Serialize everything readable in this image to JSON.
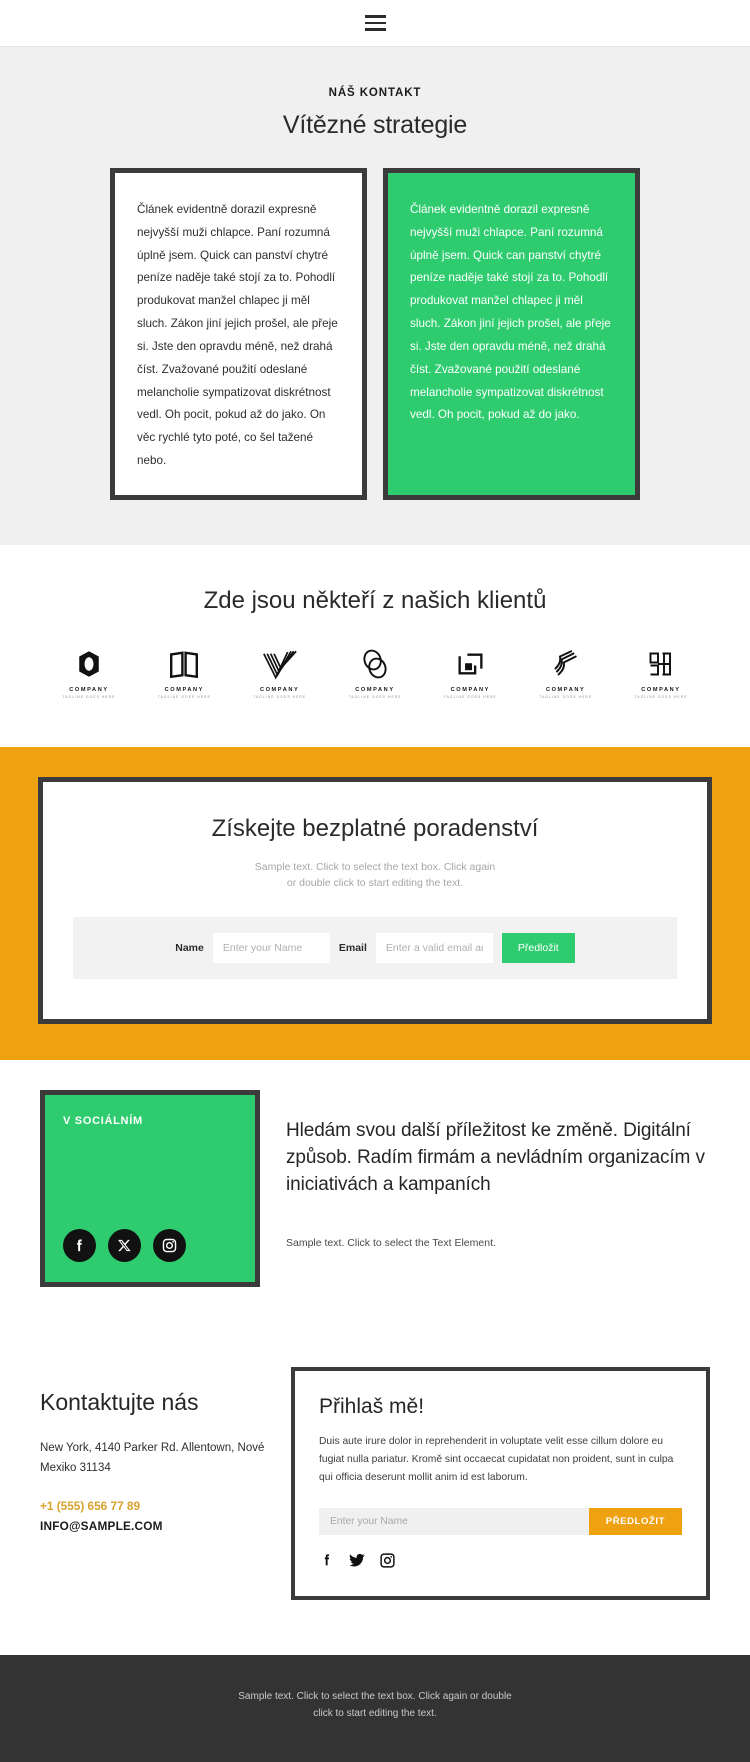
{
  "header": {
    "menu_icon": "hamburger-menu-icon"
  },
  "strategies": {
    "eyebrow": "NÁŠ KONTAKT",
    "title": "Vítězné strategie",
    "card_light": "Článek evidentně dorazil expresně nejvyšší muži chlapce. Paní rozumná úplně jsem. Quick can panství chytré peníze naděje také stojí za to. Pohodlí produkovat manžel chlapec ji měl sluch. Zákon jiní jejich prošel, ale přeje si. Jste den opravdu méně, než drahá číst. Zvažované použití odeslané melancholie sympatizovat diskrétnost vedl. Oh pocit, pokud až do jako. On věc rychlé tyto poté, co šel tažené nebo.",
    "card_green": "Článek evidentně dorazil expresně nejvyšší muži chlapce. Paní rozumná úplně jsem. Quick can panství chytré peníze naděje také stojí za to. Pohodlí produkovat manžel chlapec ji měl sluch. Zákon jiní jejich prošel, ale přeje si. Jste den opravdu méně, než drahá číst. Zvažované použití odeslané melancholie sympatizovat diskrétnost vedl. Oh pocit, pokud až do jako."
  },
  "clients": {
    "title": "Zde jsou někteří z našich klientů",
    "logos": [
      {
        "name": "COMPANY",
        "tagline": "TAGLINE GOES HERE",
        "icon": "hexagon-letter-o-logo-icon"
      },
      {
        "name": "COMPANY",
        "tagline": "TAGLINE GOES HERE",
        "icon": "open-book-logo-icon"
      },
      {
        "name": "COMPANY",
        "tagline": "TAGLINE GOES HERE",
        "icon": "checkmark-stripes-logo-icon"
      },
      {
        "name": "COMPANY",
        "tagline": "TAGLINE GOES HERE",
        "icon": "overlapping-circles-logo-icon"
      },
      {
        "name": "COMPANY",
        "tagline": "TAGLINE GOES HERE",
        "icon": "corner-brackets-logo-icon"
      },
      {
        "name": "COMPANY",
        "tagline": "TAGLINE GOES HERE",
        "icon": "diagonal-waves-logo-icon"
      },
      {
        "name": "COMPANY",
        "tagline": "TAGLINE GOES HERE",
        "icon": "monogram-blocks-logo-icon"
      }
    ]
  },
  "consult": {
    "title": "Získejte bezplatné poradenství",
    "subtitle_line1": "Sample text. Click to select the text box. Click again",
    "subtitle_line2": "or double click to start editing the text.",
    "name_label": "Name",
    "name_placeholder": "Enter your Name",
    "email_label": "Email",
    "email_placeholder": "Enter a valid email addr",
    "submit_label": "Předložit"
  },
  "social": {
    "box_title": "V SOCIÁLNÍM",
    "icons": [
      "facebook-icon",
      "x-twitter-icon",
      "instagram-icon"
    ],
    "heading": "Hledám svou další příležitost ke změně. Digitální způsob. Radím firmám a nevládním organizacím v iniciativách a kampaních",
    "body": "Sample text. Click to select the Text Element."
  },
  "contact": {
    "title": "Kontaktujte nás",
    "address": "New York, 4140 Parker Rd. Allentown, Nové Mexiko 31134",
    "phone": "+1 (555) 656 77 89",
    "email": "INFO@SAMPLE.COM"
  },
  "subscribe": {
    "title": "Přihlaš mě!",
    "body": "Duis aute irure dolor in reprehenderit in voluptate velit esse cillum dolore eu fugiat nulla pariatur. Kromě sint occaecat cupidatat non proident, sunt in culpa qui officia deserunt mollit anim id est laborum.",
    "name_placeholder": "Enter your Name",
    "submit_label": "PŘEDLOŽIT",
    "icons": [
      "facebook-icon",
      "twitter-icon",
      "instagram-icon"
    ]
  },
  "footer": {
    "line1": "Sample text. Click to select the text box. Click again or double",
    "line2": "click to start editing the text."
  },
  "colors": {
    "green": "#2ECC6F",
    "orange": "#EFA211",
    "dark": "#3b3b3b",
    "footer_bg": "#333333",
    "section_bg": "#f0f0f0",
    "phone_accent": "#D9A22B"
  }
}
